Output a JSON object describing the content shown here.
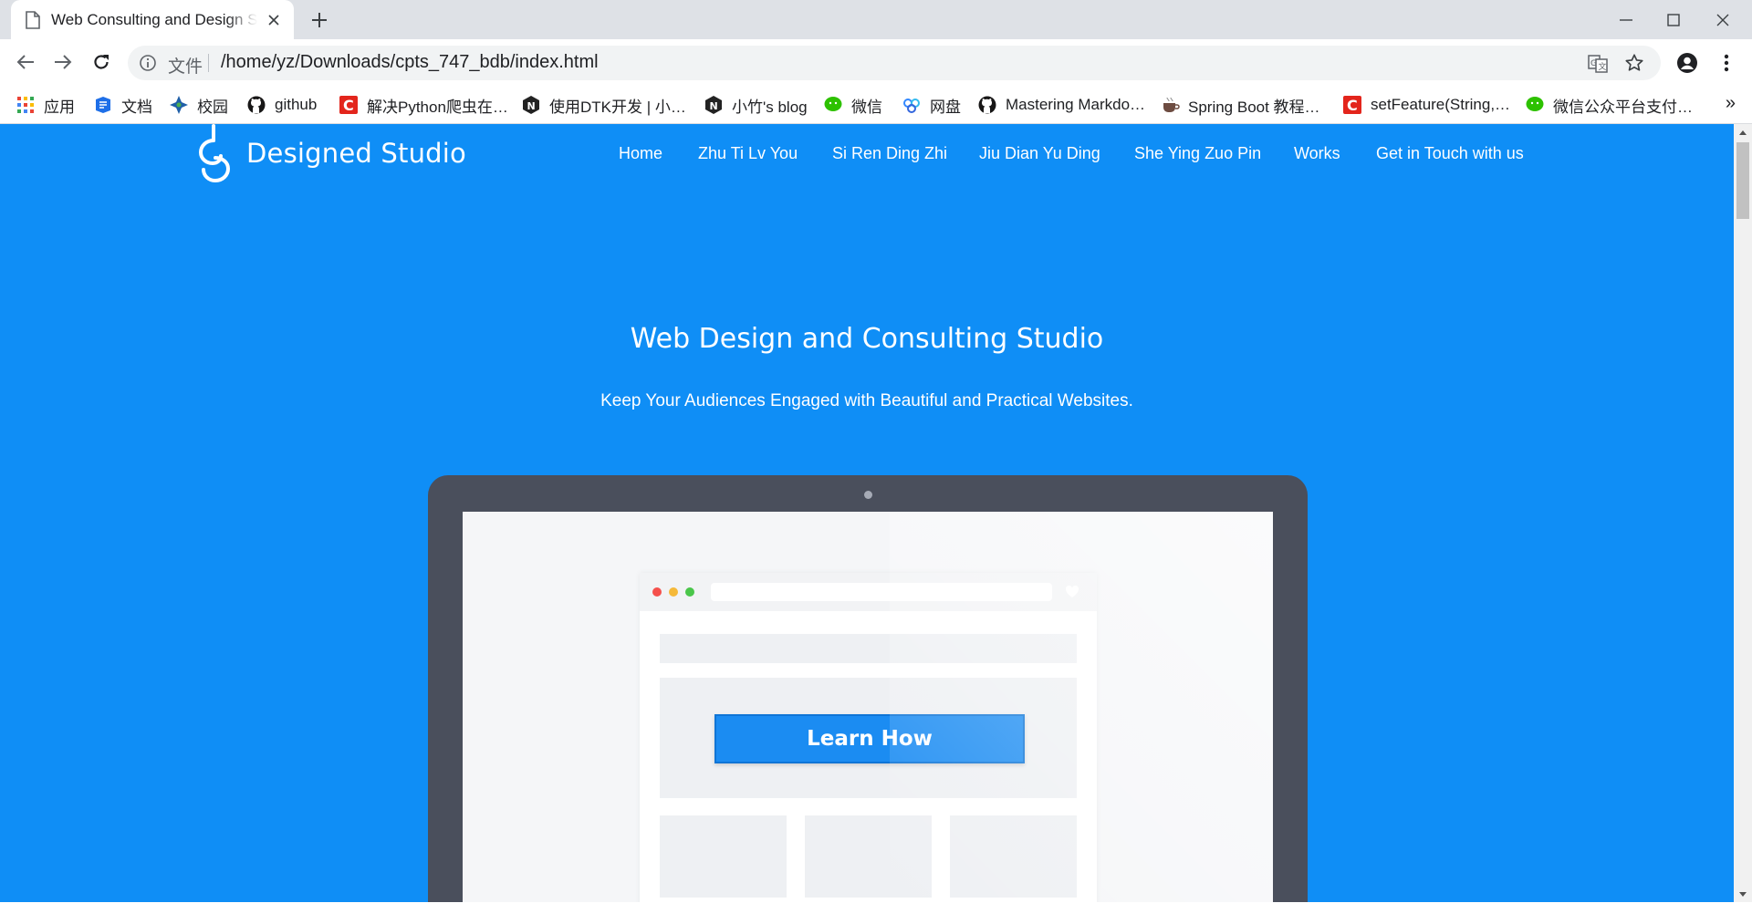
{
  "browser": {
    "tab": {
      "title": "Web Consulting and Design Studio"
    },
    "window_controls": {
      "minimize": "minimize-icon",
      "maximize": "maximize-icon",
      "close": "close-icon"
    },
    "address_bar": {
      "scheme_label": "文件",
      "url": "/home/yz/Downloads/cpts_747_bdb/index.html"
    },
    "bookmarks": [
      {
        "label": "应用",
        "icon": "apps-grid-icon"
      },
      {
        "label": "文档",
        "icon": "docs-icon"
      },
      {
        "label": "校园",
        "icon": "campus-icon"
      },
      {
        "label": "github",
        "icon": "github-icon"
      },
      {
        "label": "解决Python爬虫在…",
        "icon": "csdn-icon"
      },
      {
        "label": "使用DTK开发 | 小…",
        "icon": "notion-icon"
      },
      {
        "label": "小竹's blog",
        "icon": "notion-icon"
      },
      {
        "label": "微信",
        "icon": "wechat-icon"
      },
      {
        "label": "网盘",
        "icon": "baidu-pan-icon"
      },
      {
        "label": "Mastering Markdo…",
        "icon": "github-icon"
      },
      {
        "label": "Spring Boot 教程…",
        "icon": "coffee-icon"
      },
      {
        "label": "setFeature(String,…",
        "icon": "csdn-icon"
      },
      {
        "label": "微信公众平台支付…",
        "icon": "wechat-icon"
      }
    ],
    "more_bookmarks": "»"
  },
  "site": {
    "brand": "Designed Studio",
    "nav": [
      "Home",
      "Zhu Ti Lv You",
      "Si Ren Ding Zhi",
      "Jiu Dian Yu Ding",
      "She Ying Zuo Pin",
      "Works",
      "Get in Touch with us"
    ],
    "hero": {
      "title": "Web Design and Consulting Studio",
      "subtitle": "Keep Your Audiences Engaged with Beautiful and Practical Websites.",
      "illustration_button": "Learn How"
    },
    "colors": {
      "primary": "#0f8ef6",
      "laptop": "#4a4f5c",
      "button": "#1b8cf2"
    }
  }
}
